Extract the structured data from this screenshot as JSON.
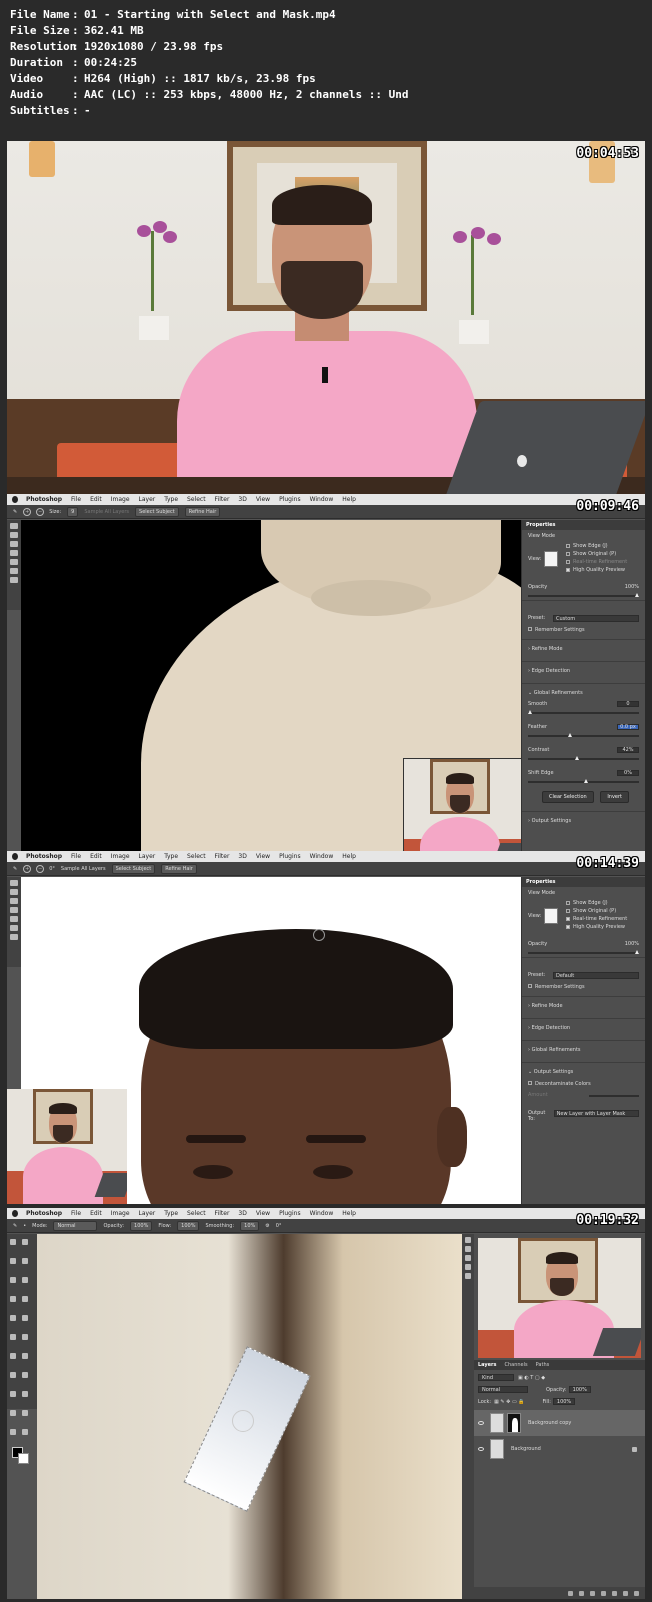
{
  "file_info": [
    {
      "key": "File Name",
      "sep": ":",
      "value": "01 - Starting with Select and Mask.mp4"
    },
    {
      "key": "File Size",
      "sep": ":",
      "value": "362.41 MB"
    },
    {
      "key": "Resolution",
      "sep": ":",
      "value": "1920x1080 / 23.98 fps"
    },
    {
      "key": "Duration",
      "sep": ":",
      "value": "00:24:25"
    },
    {
      "key": "Video",
      "sep": ":",
      "value": "H264 (High) :: 1817 kb/s, 23.98 fps"
    },
    {
      "key": "Audio",
      "sep": ":",
      "value": "AAC (LC) :: 253 kbps, 48000 Hz, 2 channels :: Und"
    },
    {
      "key": "Subtitles",
      "sep": ":",
      "value": "-"
    }
  ],
  "frames": {
    "f1": {
      "timestamp": "00:04:53"
    },
    "f2": {
      "timestamp": "00:09:46"
    },
    "f3": {
      "timestamp": "00:14:39"
    },
    "f4": {
      "timestamp": "00:19:32"
    }
  },
  "menubar": {
    "app": "Photoshop",
    "items": [
      "File",
      "Edit",
      "Image",
      "Layer",
      "Type",
      "Select",
      "Filter",
      "3D",
      "View",
      "Plugins",
      "Window",
      "Help"
    ]
  },
  "f2_options": {
    "size_label": "Size:",
    "size_value": "9",
    "sample_all": "Sample All Layers",
    "select_subject": "Select Subject",
    "refine_hair": "Refine Hair"
  },
  "f2_props": {
    "tab": "Properties",
    "view_mode": "View Mode",
    "view_label": "View:",
    "show_edge": "Show Edge (J)",
    "show_original": "Show Original (P)",
    "realtime": "Real-time Refinement",
    "hq_preview": "High Quality Preview",
    "opacity_label": "Opacity",
    "opacity_value": "100%",
    "preset_label": "Preset:",
    "preset_value": "Custom",
    "remember": "Remember Settings",
    "refine_mode": "Refine Mode",
    "edge_detection": "Edge Detection",
    "global_ref": "Global Refinements",
    "smooth_label": "Smooth",
    "smooth_value": "0",
    "feather_label": "Feather",
    "feather_value": "0.0 px",
    "contrast_label": "Contrast",
    "contrast_value": "42%",
    "shift_label": "Shift Edge",
    "shift_value": "0%",
    "clear_sel": "Clear Selection",
    "invert": "Invert",
    "output": "Output Settings"
  },
  "f3_options": {
    "size_value": "0°",
    "sample_all": "Sample All Layers",
    "select_subject": "Select Subject",
    "refine_hair": "Refine Hair"
  },
  "f3_props": {
    "tab": "Properties",
    "view_mode": "View Mode",
    "view_label": "View:",
    "show_edge": "Show Edge (J)",
    "show_original": "Show Original (P)",
    "realtime": "Real-time Refinement",
    "hq_preview": "High Quality Preview",
    "opacity_label": "Opacity",
    "opacity_value": "100%",
    "preset_label": "Preset:",
    "preset_value": "Default",
    "remember": "Remember Settings",
    "refine_mode": "Refine Mode",
    "edge_detection": "Edge Detection",
    "global_ref": "Global Refinements",
    "output": "Output Settings",
    "decontam": "Decontaminate Colors",
    "amount": "Amount",
    "output_to_label": "Output To:",
    "output_to_value": "New Layer with Layer Mask"
  },
  "f4_options": {
    "mode_label": "Mode:",
    "mode_value": "Normal",
    "opacity_label": "Opacity:",
    "opacity_value": "100%",
    "flow_label": "Flow:",
    "flow_value": "100%",
    "smoothing_label": "Smoothing:",
    "smoothing_value": "10%",
    "angle_value": "0°"
  },
  "f4_layers": {
    "tabs": [
      "Layers",
      "Channels",
      "Paths"
    ],
    "kind": "Kind",
    "blend": "Normal",
    "opacity_label": "Opacity:",
    "opacity_value": "100%",
    "lock_label": "Lock:",
    "fill_label": "Fill:",
    "fill_value": "100%",
    "layer1": "Background copy",
    "layer2": "Background"
  }
}
